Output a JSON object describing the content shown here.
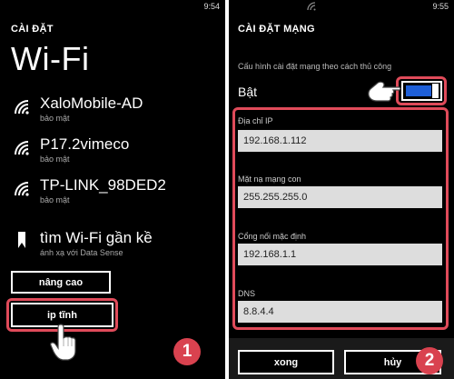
{
  "left": {
    "clock": "9:54",
    "heading": "CÀI ĐẶT",
    "title": "Wi-Fi",
    "networks": [
      {
        "name": "XaloMobile-AD",
        "sub": "bảo mật",
        "icon": "wifi-signal-icon"
      },
      {
        "name": "P17.2vimeco",
        "sub": "bảo mật",
        "icon": "wifi-signal-icon"
      },
      {
        "name": "TP-LINK_98DED2",
        "sub": "bảo mật",
        "icon": "wifi-signal-icon"
      }
    ],
    "find": {
      "name": "tìm Wi-Fi gần kề",
      "sub": "ánh xạ với Data Sense",
      "icon": "data-sense-icon"
    },
    "advanced_label": "nâng cao",
    "static_ip_label": "ip tĩnh",
    "step_badge": "1"
  },
  "right": {
    "clock": "9:55",
    "heading": "CÀI ĐẶT MẠNG",
    "manual_config_label": "Cấu hình cài đặt mạng theo cách thủ công",
    "toggle_state": "Bật",
    "fields": [
      {
        "label": "Địa chỉ IP",
        "value": "192.168.1.112"
      },
      {
        "label": "Mặt nạ mạng con",
        "value": "255.255.255.0"
      },
      {
        "label": "Cổng nối mặc định",
        "value": "192.168.1.1"
      },
      {
        "label": "DNS",
        "value": "8.8.4.4"
      }
    ],
    "done_label": "xong",
    "cancel_label": "hủy",
    "step_badge": "2"
  },
  "colors": {
    "highlight": "#e04b5a",
    "badge": "#d9424f",
    "toggle": "#1e5fd8",
    "field_bg": "#dddddd"
  }
}
